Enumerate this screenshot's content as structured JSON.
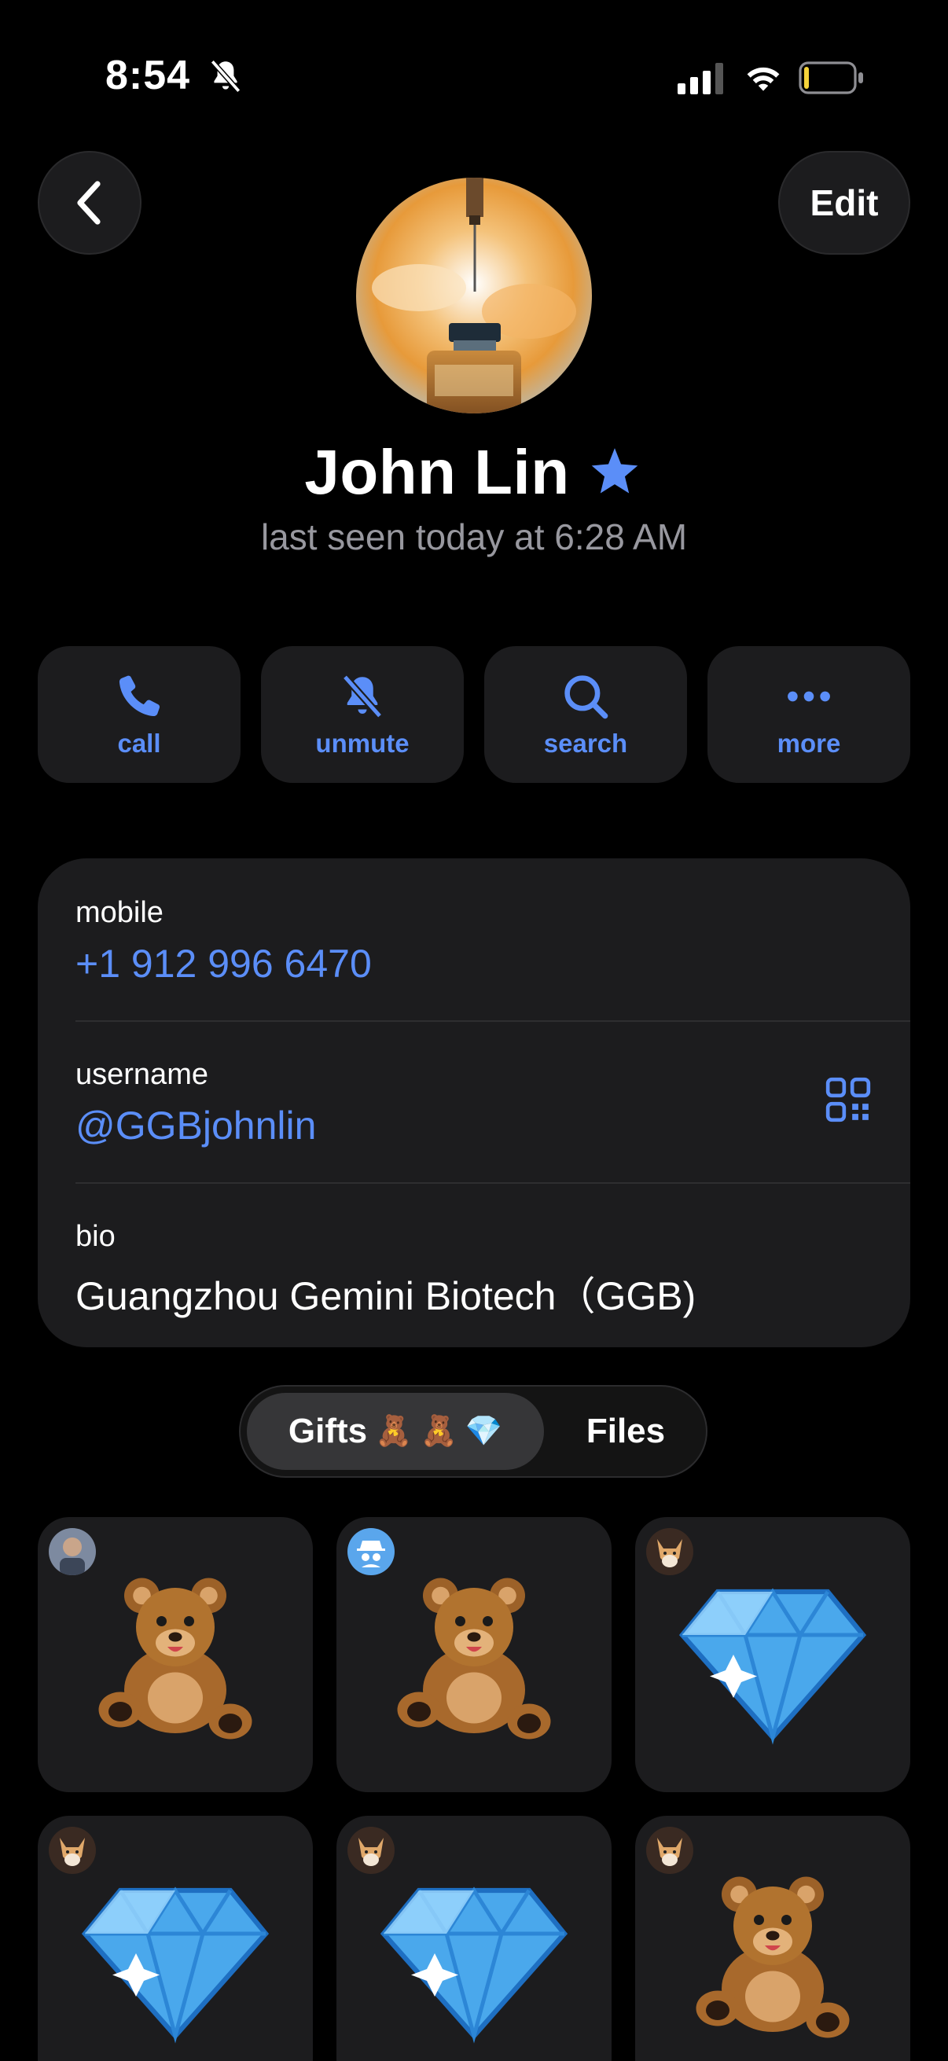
{
  "status_bar": {
    "time": "8:54"
  },
  "nav": {
    "edit_label": "Edit"
  },
  "profile": {
    "name": "John Lin",
    "last_seen": "last seen today at 6:28 AM"
  },
  "actions": [
    {
      "label": "call",
      "icon": "phone-icon"
    },
    {
      "label": "unmute",
      "icon": "bell-slash-icon"
    },
    {
      "label": "search",
      "icon": "search-icon"
    },
    {
      "label": "more",
      "icon": "ellipsis-icon"
    }
  ],
  "info": {
    "mobile_label": "mobile",
    "mobile_value": "+1 912 996 6470",
    "username_label": "username",
    "username_value": "@GGBjohnlin",
    "bio_label": "bio",
    "bio_value": "Guangzhou Gemini Biotech（GGB)"
  },
  "tabs": {
    "gifts_label": "Gifts",
    "gifts_emojis": [
      "🧸",
      "🧸",
      "💎"
    ],
    "files_label": "Files"
  },
  "gifts": [
    {
      "type": "teddy-bear",
      "sender": "photo-avatar"
    },
    {
      "type": "teddy-bear",
      "sender": "anonymous-avatar"
    },
    {
      "type": "diamond",
      "sender": "fox-avatar"
    },
    {
      "type": "diamond",
      "sender": "fox-avatar"
    },
    {
      "type": "diamond",
      "sender": "fox-avatar"
    },
    {
      "type": "teddy-bear",
      "sender": "fox-avatar"
    }
  ],
  "colors": {
    "accent": "#5b8ef8",
    "background": "#000000",
    "card": "#1c1c1e",
    "secondary_text": "#98989f"
  }
}
